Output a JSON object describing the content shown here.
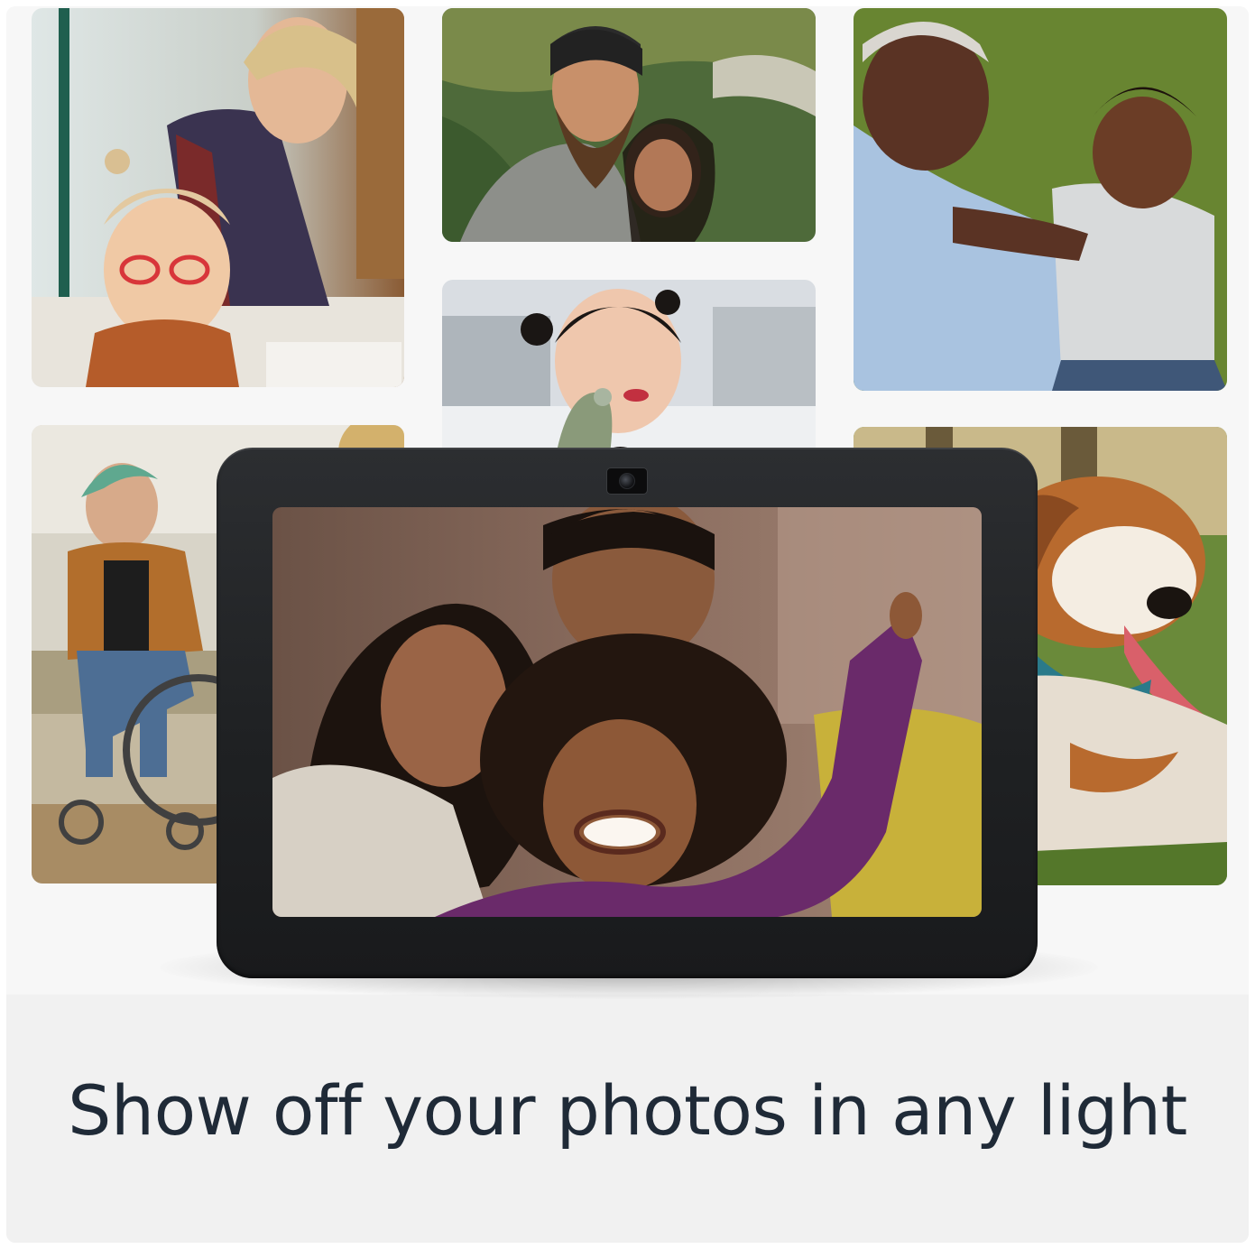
{
  "headline": "Show off your photos in any light",
  "device": {
    "type": "smart-display"
  },
  "colors": {
    "background": "#f6f6f6",
    "device_body": "#1f2123",
    "headline_text": "#1f2a37"
  }
}
